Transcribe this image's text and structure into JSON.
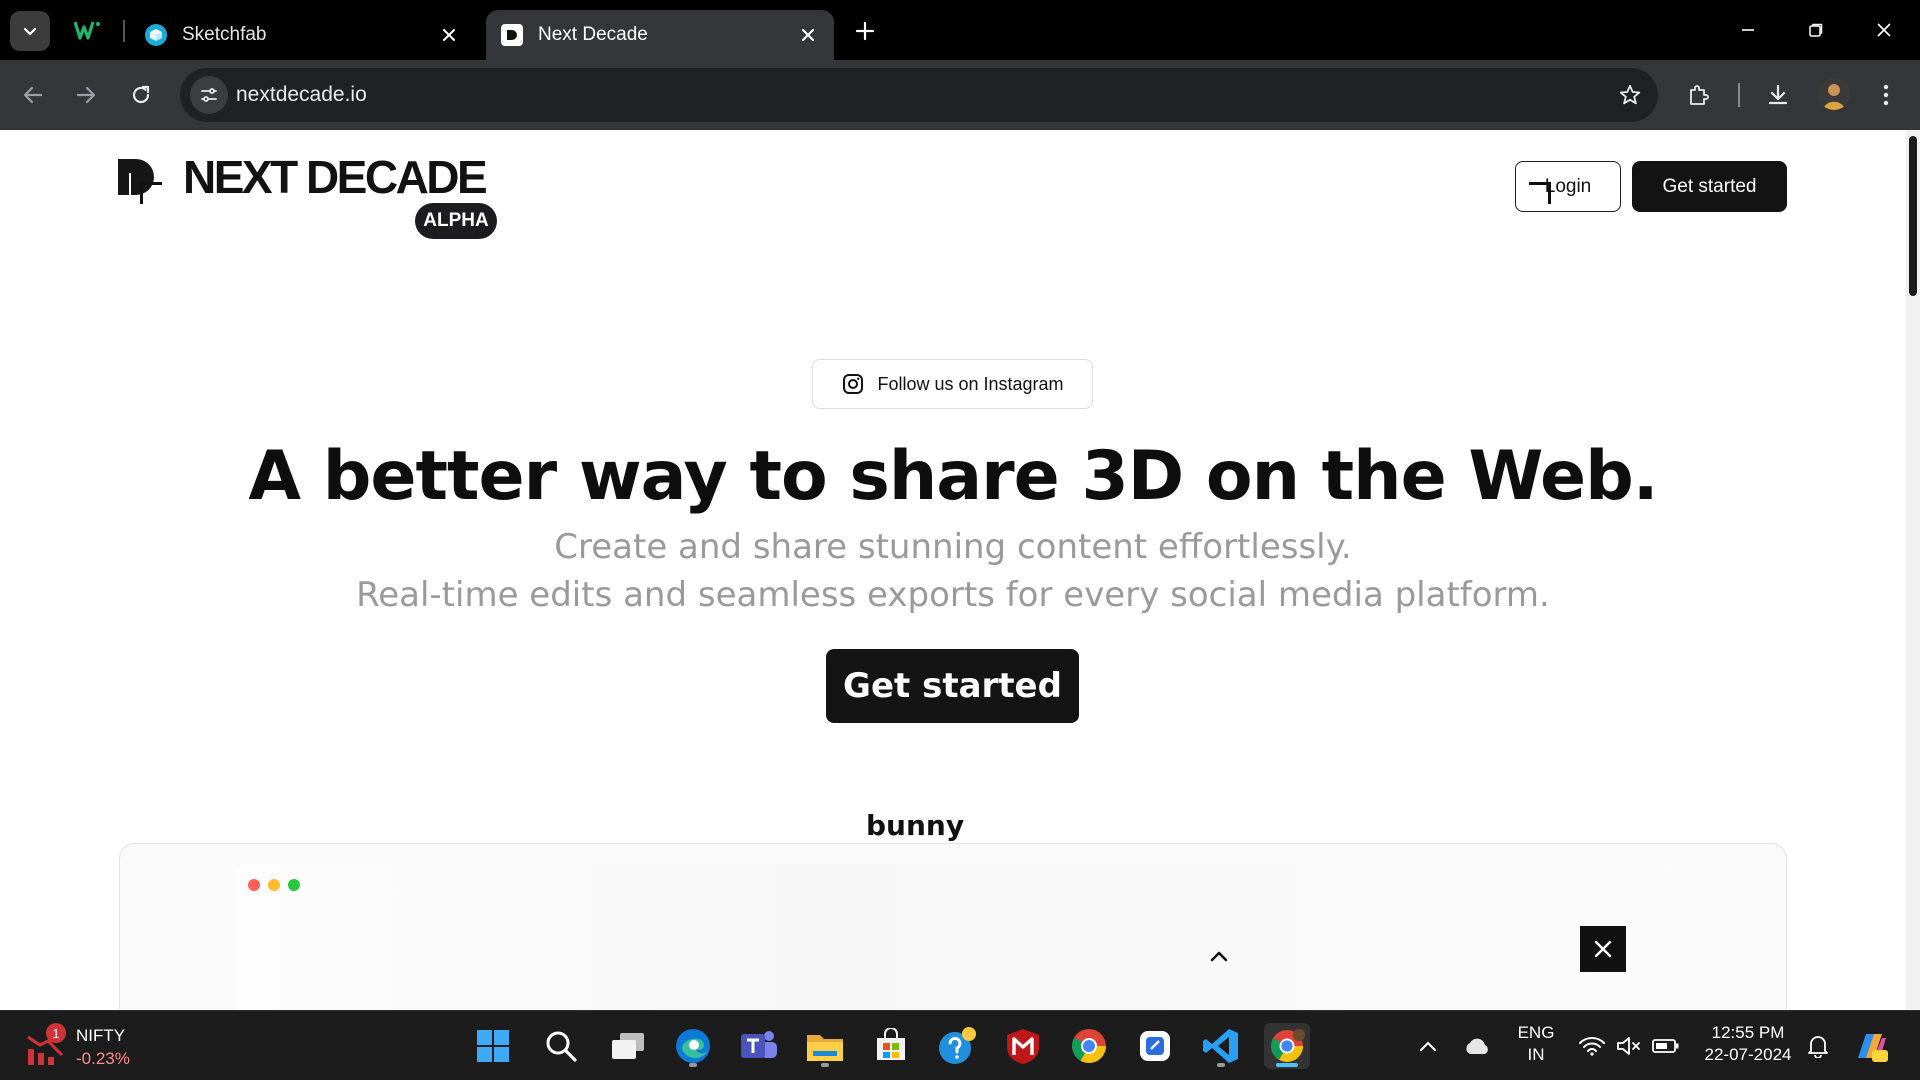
{
  "browser": {
    "tabs": [
      {
        "title": "Sketchfab",
        "favicon": "sketchfab-icon",
        "active": false
      },
      {
        "title": "Next Decade",
        "favicon": "next-decade-icon",
        "active": true
      }
    ],
    "pinned_tab_icon": "wix-icon",
    "url": "nextdecade.io"
  },
  "site": {
    "logo_text": "NEXT DECADE",
    "badge": "ALPHA",
    "nav": {
      "login": "Login",
      "get_started": "Get started"
    },
    "instagram_pill": "Follow us on Instagram",
    "headline": "A better way to share 3D on the Web.",
    "subline_1": "Create and share stunning content effortlessly.",
    "subline_2": "Real-time edits and seamless exports for every social media platform.",
    "hero_cta": "Get started",
    "preview": {
      "model_name": "bunny"
    }
  },
  "colors": {
    "accent_dark": "#131313",
    "subtext_gray": "#9a9a9a",
    "dot_red": "#ff5f57",
    "dot_yellow": "#febc2e",
    "dot_green": "#28c840"
  },
  "taskbar": {
    "widget": {
      "name": "NIFTY",
      "change": "-0.23%",
      "badge": "1"
    },
    "language": {
      "line1": "ENG",
      "line2": "IN"
    },
    "clock": {
      "time": "12:55 PM",
      "date": "22-07-2024"
    },
    "apps": [
      "start-icon",
      "search-icon",
      "task-view-icon",
      "edge-icon",
      "teams-icon",
      "file-explorer-icon",
      "store-icon",
      "help-icon",
      "mcafee-icon",
      "chrome-icon",
      "clipboard-app-icon",
      "vscode-icon",
      "chrome-profile-icon"
    ]
  }
}
